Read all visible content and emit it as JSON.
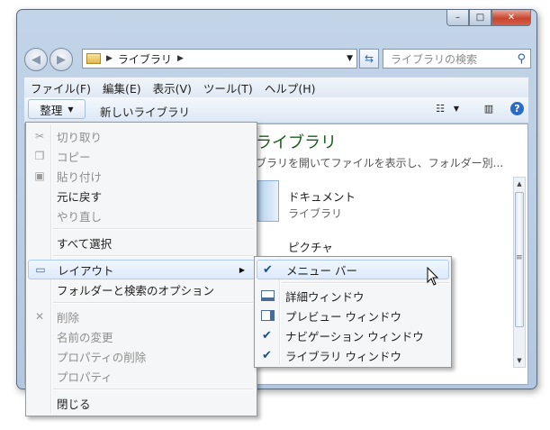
{
  "window": {
    "controls": {
      "minimize": "–",
      "maximize": "□",
      "close": "✕"
    }
  },
  "nav": {
    "back_icon": "◀",
    "forward_icon": "▶",
    "address_crumb": "ライブラリ",
    "search_placeholder": "ライブラリの検索"
  },
  "menubar": {
    "items": [
      "ファイル(F)",
      "編集(E)",
      "表示(V)",
      "ツール(T)",
      "ヘルプ(H)"
    ]
  },
  "toolbar": {
    "organize_label": "整理",
    "new_library_label": "新しいライブラリ"
  },
  "content": {
    "title": "ライブラリ",
    "description": "ブラリを開いてファイルを表示し、フォルダー別...",
    "items": [
      {
        "name": "ドキュメント",
        "sub": "ライブラリ"
      },
      {
        "name": "ピクチャ"
      }
    ]
  },
  "context_menu": {
    "cut": "切り取り",
    "copy": "コピー",
    "paste": "貼り付け",
    "undo": "元に戻す",
    "redo": "やり直し",
    "select_all": "すべて選択",
    "layout": "レイアウト",
    "folder_options": "フォルダーと検索のオプション",
    "delete": "削除",
    "rename": "名前の変更",
    "remove_properties": "プロパティの削除",
    "properties": "プロパティ",
    "close": "閉じる"
  },
  "layout_submenu": {
    "menu_bar": "メニュー バー",
    "details_pane": "詳細ウィンドウ",
    "preview_pane": "プレビュー ウィンドウ",
    "navigation_pane": "ナビゲーション ウィンドウ",
    "library_pane": "ライブラリ ウィンドウ",
    "checked": {
      "menu_bar": true,
      "details_pane": false,
      "preview_pane": false,
      "navigation_pane": true,
      "library_pane": true
    }
  }
}
